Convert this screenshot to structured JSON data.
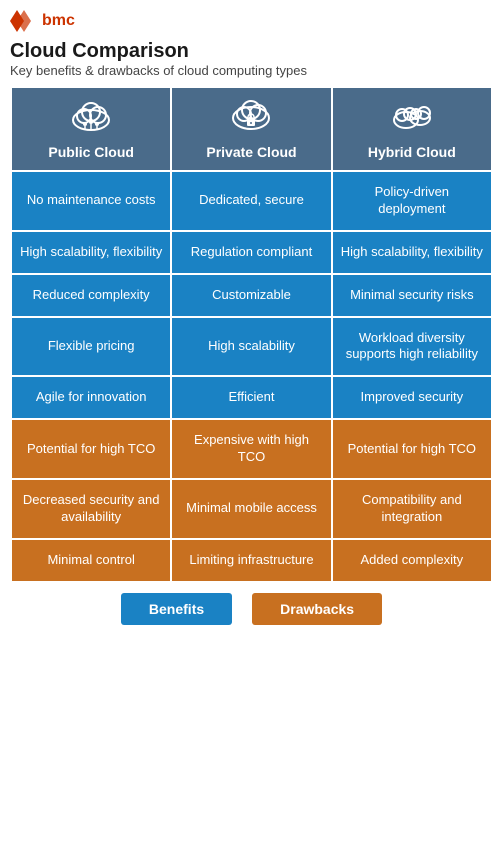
{
  "brand": {
    "logo_text": "bmc",
    "logo_icon": "▶"
  },
  "title": "Cloud Comparison",
  "subtitle": "Key benefits & drawbacks of cloud computing types",
  "columns": [
    {
      "id": "public",
      "label": "Public Cloud",
      "icon": "☁"
    },
    {
      "id": "private",
      "label": "Private Cloud",
      "icon": "🔒"
    },
    {
      "id": "hybrid",
      "label": "Hybrid Cloud",
      "icon": "☁"
    }
  ],
  "benefit_rows": [
    {
      "public": "No maintenance costs",
      "private": "Dedicated, secure",
      "hybrid": "Policy-driven deployment"
    },
    {
      "public": "High scalability, flexibility",
      "private": "Regulation compliant",
      "hybrid": "High scalability, flexibility"
    },
    {
      "public": "Reduced complexity",
      "private": "Customizable",
      "hybrid": "Minimal security risks"
    },
    {
      "public": "Flexible pricing",
      "private": "High scalability",
      "hybrid": "Workload diversity supports high reliability"
    },
    {
      "public": "Agile for innovation",
      "private": "Efficient",
      "hybrid": "Improved security"
    }
  ],
  "drawback_rows": [
    {
      "public": "Potential for high TCO",
      "private": "Expensive with high TCO",
      "hybrid": "Potential for high TCO"
    },
    {
      "public": "Decreased security and availability",
      "private": "Minimal mobile access",
      "hybrid": "Compatibility and integration"
    },
    {
      "public": "Minimal control",
      "private": "Limiting infrastructure",
      "hybrid": "Added complexity"
    }
  ],
  "legend": {
    "benefits_label": "Benefits",
    "drawbacks_label": "Drawbacks"
  }
}
